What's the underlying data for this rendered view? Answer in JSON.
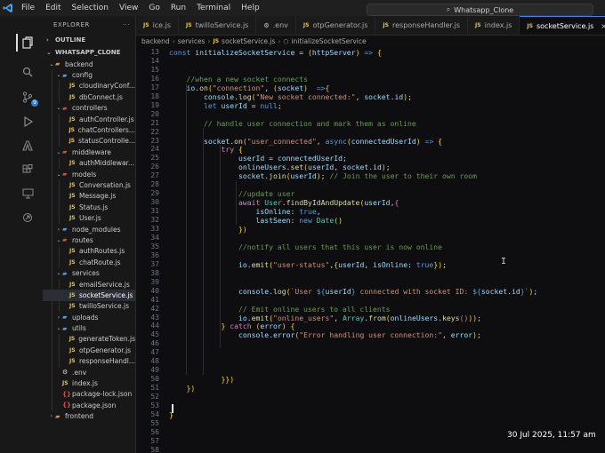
{
  "titlebar": {
    "menu": [
      "File",
      "Edit",
      "Selection",
      "View",
      "Go",
      "Run",
      "Terminal",
      "Help"
    ],
    "search": "Whatsapp_Clone"
  },
  "activity": {
    "source_control_badge": "9"
  },
  "explorer": {
    "title": "EXPLORER",
    "outline": "OUTLINE",
    "root": "WHATSAPP_CLONE",
    "tree": [
      {
        "label": "backend",
        "kind": "folder-o",
        "depth": 0,
        "open": true
      },
      {
        "label": "config",
        "kind": "folder",
        "depth": 1,
        "open": true
      },
      {
        "label": "cloudinaryConf...",
        "kind": "js",
        "depth": 2
      },
      {
        "label": "dbConnect.js",
        "kind": "js",
        "depth": 2
      },
      {
        "label": "controllers",
        "kind": "folder-r",
        "depth": 1,
        "open": true
      },
      {
        "label": "authController.js",
        "kind": "js",
        "depth": 2
      },
      {
        "label": "chatControllers...",
        "kind": "js",
        "depth": 2
      },
      {
        "label": "statusControlle...",
        "kind": "js",
        "depth": 2
      },
      {
        "label": "middleware",
        "kind": "folder-r",
        "depth": 1,
        "open": true
      },
      {
        "label": "authMiddlewar...",
        "kind": "js",
        "depth": 2
      },
      {
        "label": "models",
        "kind": "folder-r",
        "depth": 1,
        "open": true
      },
      {
        "label": "Conversation.js",
        "kind": "js",
        "depth": 2
      },
      {
        "label": "Message.js",
        "kind": "js",
        "depth": 2
      },
      {
        "label": "Status.js",
        "kind": "js",
        "depth": 2
      },
      {
        "label": "User.js",
        "kind": "js",
        "depth": 2
      },
      {
        "label": "node_modules",
        "kind": "folder",
        "depth": 1,
        "open": false
      },
      {
        "label": "routes",
        "kind": "folder-r",
        "depth": 1,
        "open": true
      },
      {
        "label": "authRoutes.js",
        "kind": "js",
        "depth": 2
      },
      {
        "label": "chatRoute.js",
        "kind": "js",
        "depth": 2
      },
      {
        "label": "services",
        "kind": "folder",
        "depth": 1,
        "open": true
      },
      {
        "label": "emailService.js",
        "kind": "js",
        "depth": 2
      },
      {
        "label": "socketService.js",
        "kind": "js",
        "depth": 2,
        "selected": true
      },
      {
        "label": "twilloService.js",
        "kind": "js",
        "depth": 2
      },
      {
        "label": "uploads",
        "kind": "folder",
        "depth": 1,
        "open": false
      },
      {
        "label": "utils",
        "kind": "folder",
        "depth": 1,
        "open": true
      },
      {
        "label": "generateToken.js",
        "kind": "js",
        "depth": 2
      },
      {
        "label": "otpGenerator.js",
        "kind": "js",
        "depth": 2
      },
      {
        "label": "responseHandl...",
        "kind": "js",
        "depth": 2
      },
      {
        "label": ".env",
        "kind": "env",
        "depth": 1
      },
      {
        "label": "index.js",
        "kind": "js",
        "depth": 1
      },
      {
        "label": "package-lock.json",
        "kind": "json",
        "depth": 1
      },
      {
        "label": "package.json",
        "kind": "json",
        "depth": 1
      },
      {
        "label": "frontend",
        "kind": "folder-o",
        "depth": 0,
        "open": false
      }
    ]
  },
  "tabs": [
    {
      "label": "ice.js",
      "icon": "JS"
    },
    {
      "label": "twilloService.js",
      "icon": "JS"
    },
    {
      "label": ".env",
      "icon": "⚙"
    },
    {
      "label": "otpGenerator.js",
      "icon": "JS"
    },
    {
      "label": "responseHandler.js",
      "icon": "JS"
    },
    {
      "label": "index.js",
      "icon": "JS"
    },
    {
      "label": "socketService.js",
      "icon": "JS",
      "active": true,
      "close": "×"
    }
  ],
  "breadcrumb": {
    "parts": [
      "backend",
      "services",
      "socketService.js",
      "initializeSocketService"
    ],
    "file_icon": "JS"
  },
  "editor": {
    "first_line": 13,
    "current_line": 60,
    "lines": [
      "const initializeSocketService = (httpServer) => {",
      "",
      "",
      "    //when a new socket connects",
      "    io.on(\"connection\", (socket)  =>{",
      "        console.log(\"New socket connected:\", socket.id);",
      "        let userId = null;",
      "",
      "        // handle user connection and mark them as online",
      "",
      "        socket.on(\"user_connected\", async(connectedUserId) => {",
      "            try {",
      "                userId = connectedUserId;",
      "                onlineUsers.set(userId, socket.id);",
      "                socket.join(userId); // Join the user to their own room",
      "",
      "                //update user",
      "                await User.findByIdAndUpdate(userId,{",
      "                    isOnline: true,",
      "                    lastSeen: new Date()",
      "                })",
      "",
      "                //notify all users that this user is now online",
      "",
      "                io.emit(\"user-status\",{userId, isOnline: true});",
      "",
      "",
      "                console.log(`User ${userId} connected with socket ID: ${socket.id}`);",
      "",
      "                // Emit online users to all clients",
      "                io.emit(\"online_users\", Array.from(onlineUsers.keys()));",
      "            } catch (error) {",
      "                console.error(\"Error handling user connection:\", error);",
      "",
      "",
      "",
      "",
      "            }})",
      "    })",
      "",
      "",
      "}",
      "",
      "",
      "",
      "",
      "",
      ""
    ]
  },
  "status": {
    "datetime": "30 Jul 2025, 11:57 am"
  },
  "colors": {
    "accent": "#3b82f6",
    "editor_bg": "#0e0e10",
    "sidebar_bg": "#181818"
  }
}
